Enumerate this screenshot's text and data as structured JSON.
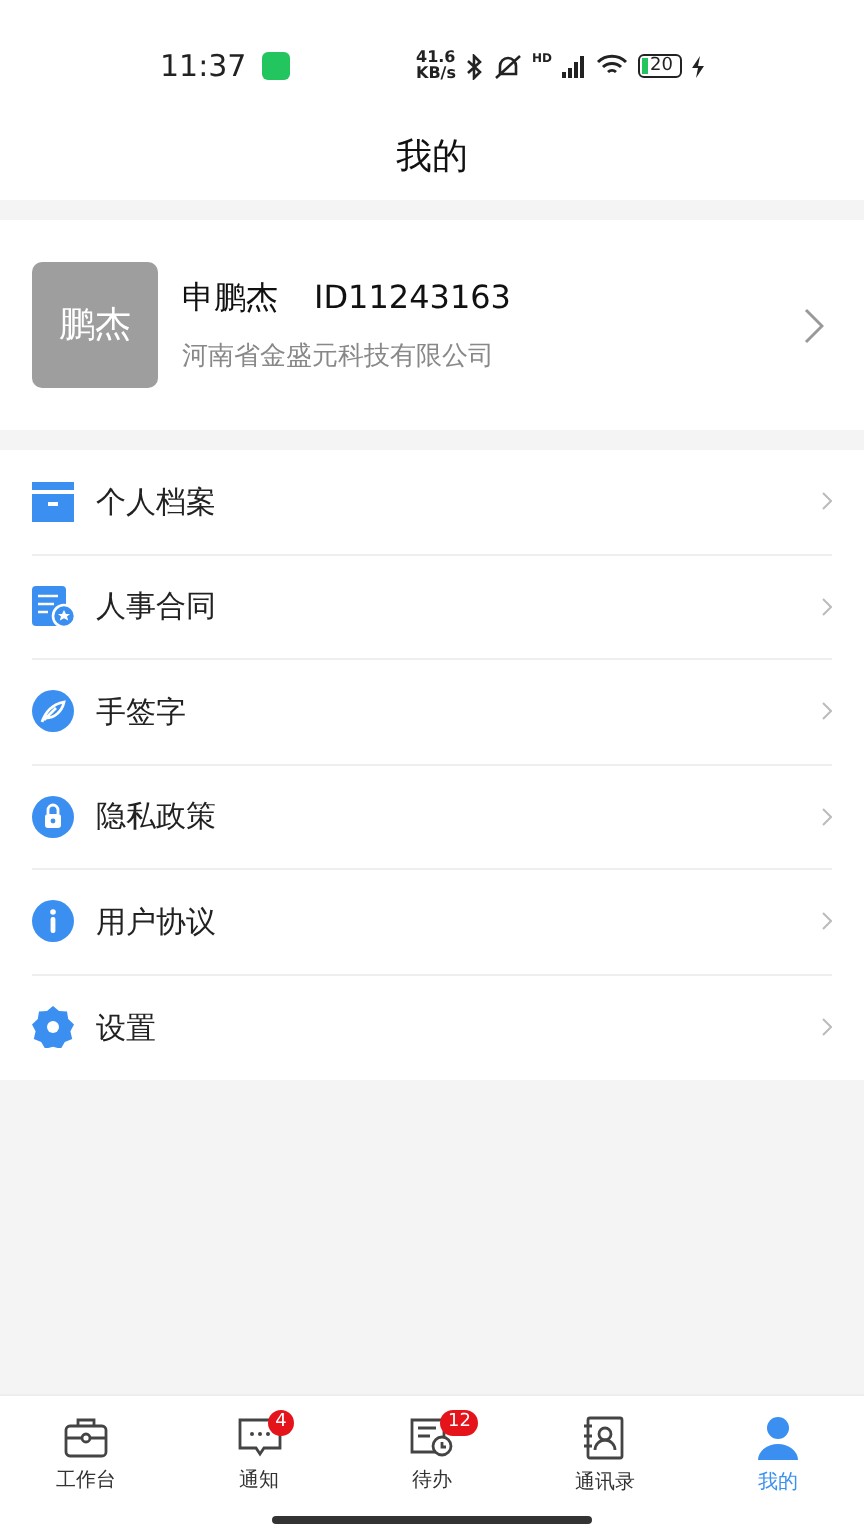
{
  "status_bar": {
    "time": "11:37",
    "net_speed": "41.6",
    "net_unit": "KB/s",
    "signal_label": "HD",
    "battery": "20"
  },
  "title": "我的",
  "profile": {
    "avatar_text": "鹏杰",
    "name": "申鹏杰",
    "id": "ID11243163",
    "company": "河南省金盛元科技有限公司"
  },
  "menu": [
    {
      "kind": "archive",
      "label": "个人档案"
    },
    {
      "kind": "contract",
      "label": "人事合同"
    },
    {
      "kind": "signature",
      "label": "手签字"
    },
    {
      "kind": "privacy",
      "label": "隐私政策"
    },
    {
      "kind": "info",
      "label": "用户协议"
    },
    {
      "kind": "settings",
      "label": "设置"
    }
  ],
  "tabs": [
    {
      "kind": "workbench",
      "label": "工作台",
      "selected": false
    },
    {
      "kind": "notice",
      "label": "通知",
      "badge": "4",
      "selected": false
    },
    {
      "kind": "todo",
      "label": "待办",
      "badge": "12",
      "selected": false
    },
    {
      "kind": "contacts",
      "label": "通讯录",
      "selected": false
    },
    {
      "kind": "me",
      "label": "我的",
      "selected": true
    }
  ]
}
